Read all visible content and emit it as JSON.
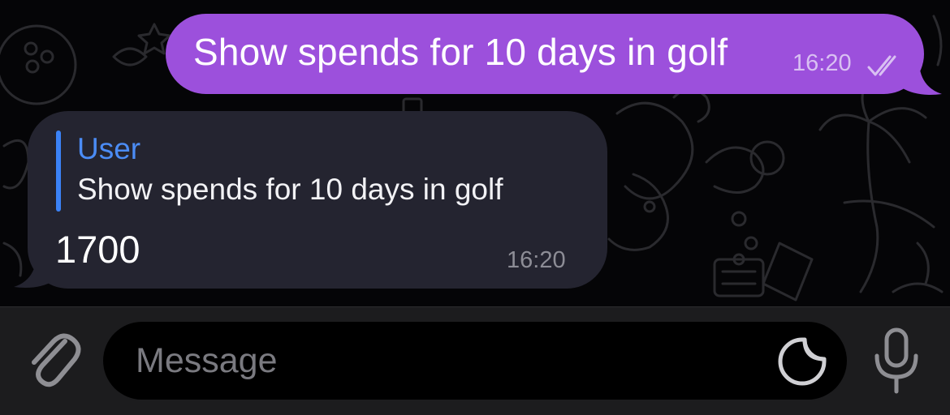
{
  "conversation": {
    "outgoing_message": {
      "text": "Show spends for 10 days in golf",
      "time": "16:20",
      "status_icon": "double-check-icon",
      "bubble_color": "#9c50dc"
    },
    "incoming_message": {
      "reply_to": {
        "author": "User",
        "text": "Show spends for 10 days in golf",
        "accent_color": "#3b82f6"
      },
      "text": "1700",
      "time": "16:20",
      "bubble_color": "#242430"
    }
  },
  "composer": {
    "placeholder": "Message",
    "attach_icon": "paperclip-icon",
    "sticker_icon": "sticker-icon",
    "mic_icon": "microphone-icon"
  }
}
